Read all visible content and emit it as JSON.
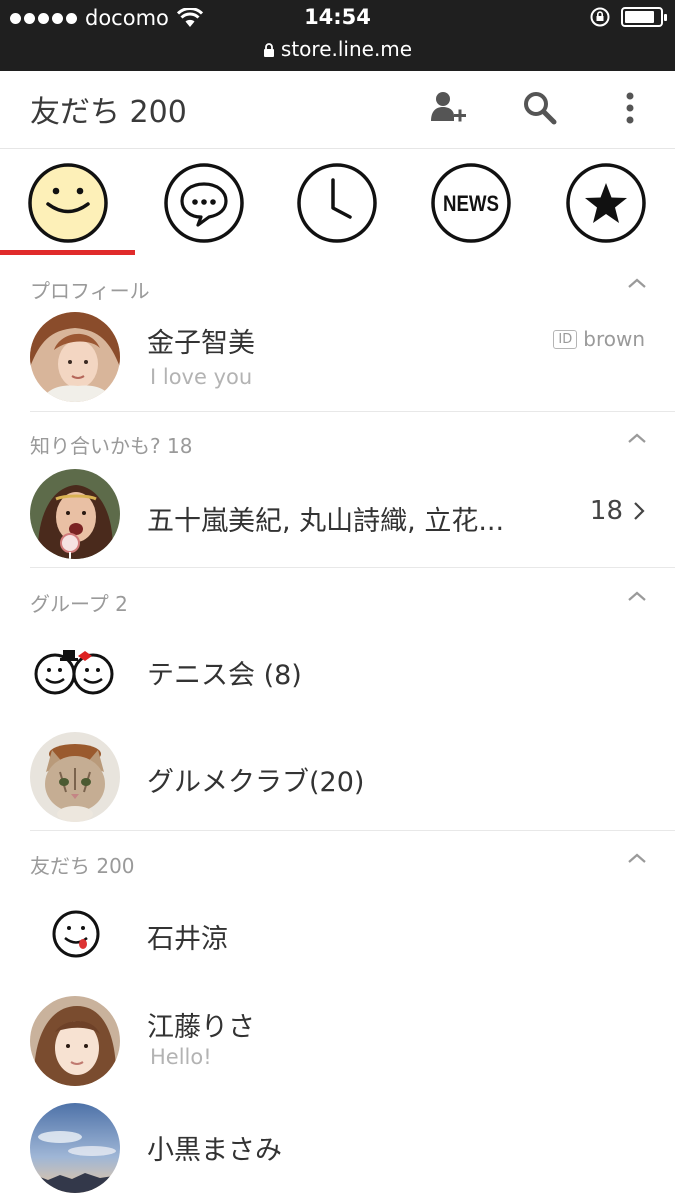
{
  "status_bar": {
    "carrier": "docomo",
    "time": "14:54",
    "url": "store.line.me",
    "battery_level": 0.85,
    "signal_bars": 5
  },
  "header": {
    "title": "友だち 200",
    "icons": [
      "add-friend-icon",
      "search-icon",
      "more-icon"
    ]
  },
  "tabs": [
    {
      "name": "friends",
      "icon": "smiley-face-icon",
      "active": true
    },
    {
      "name": "chats",
      "icon": "chat-bubble-icon",
      "active": false
    },
    {
      "name": "timeline",
      "icon": "clock-icon",
      "active": false
    },
    {
      "name": "news",
      "icon": "news-icon",
      "label": "NEWS",
      "active": false
    },
    {
      "name": "more",
      "icon": "star-icon",
      "active": false
    }
  ],
  "sections": {
    "profile": {
      "title": "プロフィール",
      "name": "金子智美",
      "status": "I love you",
      "id_label": "ID",
      "id_value": "brown"
    },
    "suggested": {
      "title": "知り合いかも? 18",
      "names": "五十嵐美紀, 丸山詩織, 立花...",
      "count": "18"
    },
    "groups": {
      "title": "グループ  2",
      "items": [
        {
          "name": "テニス会 (8)"
        },
        {
          "name": "グルメクラブ(20)"
        }
      ]
    },
    "friends": {
      "title": "友だち 200",
      "items": [
        {
          "name": "石井涼",
          "status": ""
        },
        {
          "name": "江藤りさ",
          "status": "Hello!"
        },
        {
          "name": "小黒まさみ",
          "status": ""
        }
      ]
    }
  },
  "colors": {
    "accent": "#e02b2b",
    "status_bar": "#1f1f1f",
    "avatar_face": "#fdf0b8"
  }
}
